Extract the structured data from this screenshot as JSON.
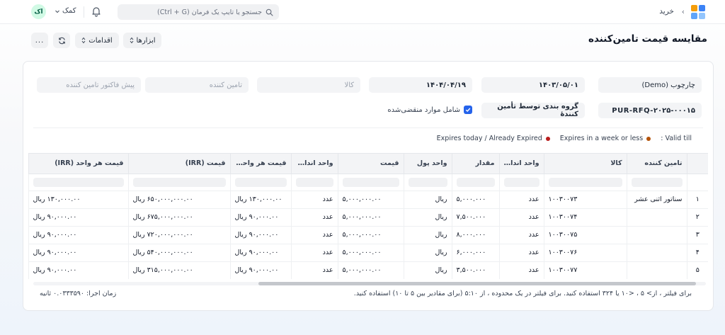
{
  "navbar": {
    "breadcrumb": "خرید",
    "search_placeholder": "جستجو یا تایپ یک فرمان (Ctrl + G)",
    "help_label": "کمک",
    "avatar_initials": "اک",
    "logo_colors": [
      "#3b82f6",
      "#f59e0b",
      "#60a5fa",
      "#93c5fd"
    ]
  },
  "page": {
    "title": "مقایسه قیمت تامین‌کننده"
  },
  "toolbar": {
    "tools_label": "ابزارها",
    "actions_label": "اقدامات",
    "more_label": "..."
  },
  "filters": {
    "company": "چارچوب (Demo)",
    "from_date": "۱۴۰۳/۰۵/۰۱",
    "to_date": "۱۴۰۴/۰۴/۱۹",
    "item_placeholder": "کالا",
    "supplier_placeholder": "تامین کننده",
    "quotation_placeholder": "پیش فاکتور تامین کننده",
    "rfq": "PUR-RFQ-۲۰۲۵-۰۰۰۱۵",
    "group_by": "گروه بندی توسط تأمین کنندهٔ",
    "include_expired_label": "شامل موارد منقضی‌شده",
    "include_expired_checked": true
  },
  "legend": {
    "valid_till": ": Valid till",
    "expires_week": "Expires in a week or less",
    "expires_today": "Expires today / Already Expired",
    "week_color": "#b45309",
    "today_color": "#b91c1c"
  },
  "table": {
    "columns": [
      "تامین کننده",
      "کالا",
      "واحد اندازه…",
      "مقدار",
      "واحد پول",
      "قیمت",
      "واحد اندازه…",
      "قیمت هر واحد…",
      "قیمت (IRR)",
      "قیمت هر واحد (IRR)"
    ],
    "rows": [
      {
        "idx": "۱",
        "supplier": "سناتور اثنی عشر",
        "item": "۱۰۰۳۰۰۷۳",
        "uom": "عدد",
        "qty": "۵,۰۰۰.۰۰۰",
        "currency": "ریال",
        "price": "۵,۰۰۰,۰۰۰.۰۰",
        "stock_uom": "عدد",
        "unit_price": "۱۳۰,۰۰۰.۰۰ ریال",
        "price_irr": "۶۵۰,۰۰۰,۰۰۰.۰۰ ریال",
        "unit_price_irr": "۱۳۰,۰۰۰.۰۰ ریال"
      },
      {
        "idx": "۲",
        "supplier": "",
        "item": "۱۰۰۳۰۰۷۴",
        "uom": "عدد",
        "qty": "۷,۵۰۰.۰۰۰",
        "currency": "ریال",
        "price": "۵,۰۰۰,۰۰۰.۰۰",
        "stock_uom": "عدد",
        "unit_price": "۹۰,۰۰۰.۰۰ ریال",
        "price_irr": "۶۷۵,۰۰۰,۰۰۰.۰۰ ریال",
        "unit_price_irr": "۹۰,۰۰۰.۰۰ ریال"
      },
      {
        "idx": "۳",
        "supplier": "",
        "item": "۱۰۰۳۰۰۷۵",
        "uom": "عدد",
        "qty": "۸,۰۰۰.۰۰۰",
        "currency": "ریال",
        "price": "۵,۰۰۰,۰۰۰.۰۰",
        "stock_uom": "عدد",
        "unit_price": "۹۰,۰۰۰.۰۰ ریال",
        "price_irr": "۷۲۰,۰۰۰,۰۰۰.۰۰ ریال",
        "unit_price_irr": "۹۰,۰۰۰.۰۰ ریال"
      },
      {
        "idx": "۴",
        "supplier": "",
        "item": "۱۰۰۳۰۰۷۶",
        "uom": "عدد",
        "qty": "۶,۰۰۰.۰۰۰",
        "currency": "ریال",
        "price": "۵,۰۰۰,۰۰۰.۰۰",
        "stock_uom": "عدد",
        "unit_price": "۹۰,۰۰۰.۰۰ ریال",
        "price_irr": "۵۴۰,۰۰۰,۰۰۰.۰۰ ریال",
        "unit_price_irr": "۹۰,۰۰۰.۰۰ ریال"
      },
      {
        "idx": "۵",
        "supplier": "",
        "item": "۱۰۰۳۰۰۷۷",
        "uom": "عدد",
        "qty": "۳,۵۰۰.۰۰۰",
        "currency": "ریال",
        "price": "۵,۰۰۰,۰۰۰.۰۰",
        "stock_uom": "عدد",
        "unit_price": "۹۰,۰۰۰.۰۰ ریال",
        "price_irr": "۳۱۵,۰۰۰,۰۰۰.۰۰ ریال",
        "unit_price_irr": "۹۰,۰۰۰.۰۰ ریال"
      }
    ]
  },
  "footer": {
    "filter_hint": "برای فیلتر ، از> ۵ ، <۱۰ یا ۳۲۴ استفاده کنید. برای فیلتر در یک محدوده ، از ۵:۱۰ (برای مقادیر بین ۵ تا ۱۰) استفاده کنید.",
    "exec_time": "زمان اجرا: ۰.۰۳۳۳۵۹۰ ثانیه"
  }
}
